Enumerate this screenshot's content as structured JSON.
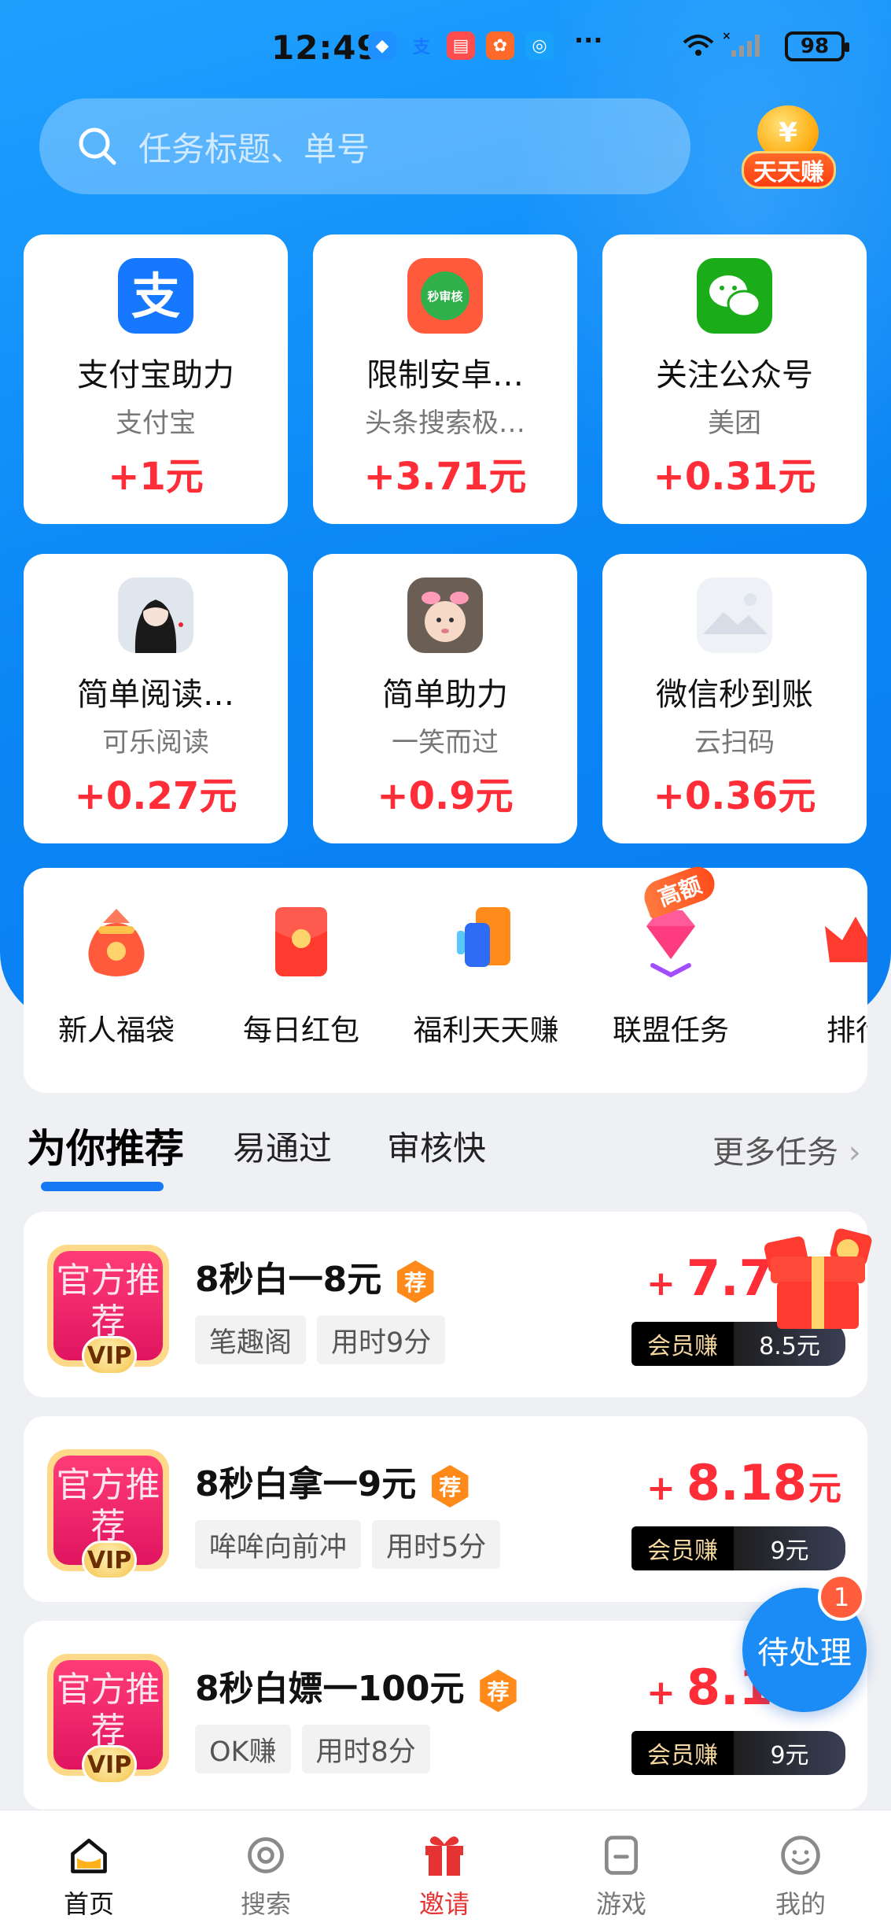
{
  "status_bar": {
    "time": "12:49",
    "battery": "98",
    "more": "···"
  },
  "search": {
    "placeholder": "任务标题、单号"
  },
  "promo_badge": {
    "label": "天天赚",
    "coin": "¥"
  },
  "task_cards": [
    {
      "title": "支付宝助力",
      "subtitle": "支付宝",
      "price": "+1元",
      "icon": "alipay-icon"
    },
    {
      "title": "限制安卓…",
      "subtitle": "头条搜索极…",
      "price": "+3.71元",
      "icon": "miaoshenhe-icon",
      "icon_text": "秒审核"
    },
    {
      "title": "关注公众号",
      "subtitle": "美团",
      "price": "+0.31元",
      "icon": "wechat-icon"
    },
    {
      "title": "简单阅读…",
      "subtitle": "可乐阅读",
      "price": "+0.27元",
      "icon": "avatar-girl-icon"
    },
    {
      "title": "简单助力",
      "subtitle": "一笑而过",
      "price": "+0.9元",
      "icon": "avatar-baby-icon"
    },
    {
      "title": "微信秒到账",
      "subtitle": "云扫码",
      "price": "+0.36元",
      "icon": "image-placeholder-icon"
    }
  ],
  "features": [
    {
      "label": "新人福袋",
      "icon": "lucky-bag-icon"
    },
    {
      "label": "每日红包",
      "icon": "red-envelope-icon"
    },
    {
      "label": "福利天天赚",
      "icon": "welfare-phone-icon"
    },
    {
      "label": "联盟任务",
      "icon": "diamond-icon"
    },
    {
      "label": "排行",
      "icon": "crown-icon"
    }
  ],
  "hot_tag": "高额",
  "tabs": {
    "items": [
      "为你推荐",
      "易通过",
      "审核快"
    ],
    "more": "更多任务"
  },
  "vip_badge": {
    "text": "官方推荐",
    "vip": "VIP"
  },
  "rec_mark": "荐",
  "list": [
    {
      "title": "8秒白一8元",
      "tags": [
        "笔趣阁",
        "用时9分"
      ],
      "price": "7.7",
      "unit": "",
      "member_label": "会员赚",
      "member_price": "8.5元"
    },
    {
      "title": "8秒白拿一9元",
      "tags": [
        "哞哞向前冲",
        "用时5分"
      ],
      "price": "8.18",
      "unit": "元",
      "member_label": "会员赚",
      "member_price": "9元"
    },
    {
      "title": "8秒白嫖一100元",
      "tags": [
        "OK赚",
        "用时8分"
      ],
      "price": "8.1",
      "unit": "",
      "member_label": "会员赚",
      "member_price": "9元"
    }
  ],
  "plus_sign": "+",
  "pending": {
    "label": "待处理",
    "count": "1"
  },
  "nav": [
    {
      "label": "首页",
      "icon": "home-icon"
    },
    {
      "label": "搜索",
      "icon": "search-icon"
    },
    {
      "label": "邀请",
      "icon": "gift-icon"
    },
    {
      "label": "游戏",
      "icon": "game-icon"
    },
    {
      "label": "我的",
      "icon": "profile-icon"
    }
  ],
  "colors": {
    "primary": "#0b86f5",
    "price": "#ff2d38",
    "accent": "#ff8a1a"
  }
}
